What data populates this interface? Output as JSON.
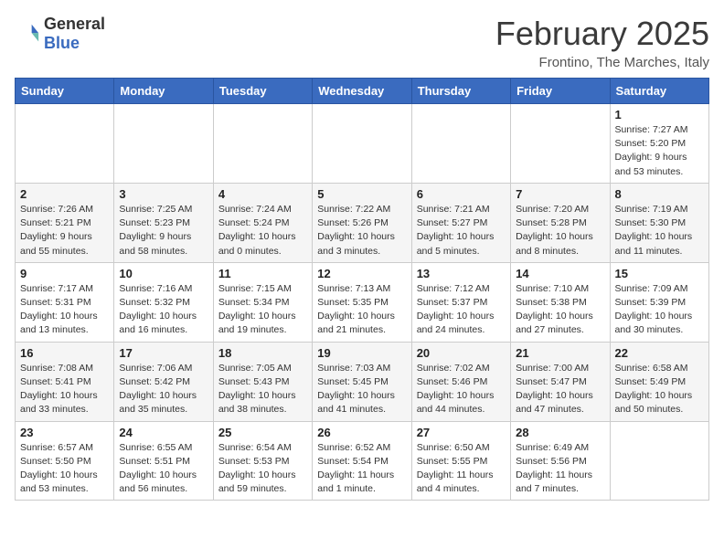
{
  "header": {
    "logo_general": "General",
    "logo_blue": "Blue",
    "month_title": "February 2025",
    "location": "Frontino, The Marches, Italy"
  },
  "days_of_week": [
    "Sunday",
    "Monday",
    "Tuesday",
    "Wednesday",
    "Thursday",
    "Friday",
    "Saturday"
  ],
  "weeks": [
    {
      "row_class": "row-white",
      "days": [
        {
          "num": "",
          "info": ""
        },
        {
          "num": "",
          "info": ""
        },
        {
          "num": "",
          "info": ""
        },
        {
          "num": "",
          "info": ""
        },
        {
          "num": "",
          "info": ""
        },
        {
          "num": "",
          "info": ""
        },
        {
          "num": "1",
          "info": "Sunrise: 7:27 AM\nSunset: 5:20 PM\nDaylight: 9 hours and 53 minutes."
        }
      ]
    },
    {
      "row_class": "row-alt",
      "days": [
        {
          "num": "2",
          "info": "Sunrise: 7:26 AM\nSunset: 5:21 PM\nDaylight: 9 hours and 55 minutes."
        },
        {
          "num": "3",
          "info": "Sunrise: 7:25 AM\nSunset: 5:23 PM\nDaylight: 9 hours and 58 minutes."
        },
        {
          "num": "4",
          "info": "Sunrise: 7:24 AM\nSunset: 5:24 PM\nDaylight: 10 hours and 0 minutes."
        },
        {
          "num": "5",
          "info": "Sunrise: 7:22 AM\nSunset: 5:26 PM\nDaylight: 10 hours and 3 minutes."
        },
        {
          "num": "6",
          "info": "Sunrise: 7:21 AM\nSunset: 5:27 PM\nDaylight: 10 hours and 5 minutes."
        },
        {
          "num": "7",
          "info": "Sunrise: 7:20 AM\nSunset: 5:28 PM\nDaylight: 10 hours and 8 minutes."
        },
        {
          "num": "8",
          "info": "Sunrise: 7:19 AM\nSunset: 5:30 PM\nDaylight: 10 hours and 11 minutes."
        }
      ]
    },
    {
      "row_class": "row-white",
      "days": [
        {
          "num": "9",
          "info": "Sunrise: 7:17 AM\nSunset: 5:31 PM\nDaylight: 10 hours and 13 minutes."
        },
        {
          "num": "10",
          "info": "Sunrise: 7:16 AM\nSunset: 5:32 PM\nDaylight: 10 hours and 16 minutes."
        },
        {
          "num": "11",
          "info": "Sunrise: 7:15 AM\nSunset: 5:34 PM\nDaylight: 10 hours and 19 minutes."
        },
        {
          "num": "12",
          "info": "Sunrise: 7:13 AM\nSunset: 5:35 PM\nDaylight: 10 hours and 21 minutes."
        },
        {
          "num": "13",
          "info": "Sunrise: 7:12 AM\nSunset: 5:37 PM\nDaylight: 10 hours and 24 minutes."
        },
        {
          "num": "14",
          "info": "Sunrise: 7:10 AM\nSunset: 5:38 PM\nDaylight: 10 hours and 27 minutes."
        },
        {
          "num": "15",
          "info": "Sunrise: 7:09 AM\nSunset: 5:39 PM\nDaylight: 10 hours and 30 minutes."
        }
      ]
    },
    {
      "row_class": "row-alt",
      "days": [
        {
          "num": "16",
          "info": "Sunrise: 7:08 AM\nSunset: 5:41 PM\nDaylight: 10 hours and 33 minutes."
        },
        {
          "num": "17",
          "info": "Sunrise: 7:06 AM\nSunset: 5:42 PM\nDaylight: 10 hours and 35 minutes."
        },
        {
          "num": "18",
          "info": "Sunrise: 7:05 AM\nSunset: 5:43 PM\nDaylight: 10 hours and 38 minutes."
        },
        {
          "num": "19",
          "info": "Sunrise: 7:03 AM\nSunset: 5:45 PM\nDaylight: 10 hours and 41 minutes."
        },
        {
          "num": "20",
          "info": "Sunrise: 7:02 AM\nSunset: 5:46 PM\nDaylight: 10 hours and 44 minutes."
        },
        {
          "num": "21",
          "info": "Sunrise: 7:00 AM\nSunset: 5:47 PM\nDaylight: 10 hours and 47 minutes."
        },
        {
          "num": "22",
          "info": "Sunrise: 6:58 AM\nSunset: 5:49 PM\nDaylight: 10 hours and 50 minutes."
        }
      ]
    },
    {
      "row_class": "row-white",
      "days": [
        {
          "num": "23",
          "info": "Sunrise: 6:57 AM\nSunset: 5:50 PM\nDaylight: 10 hours and 53 minutes."
        },
        {
          "num": "24",
          "info": "Sunrise: 6:55 AM\nSunset: 5:51 PM\nDaylight: 10 hours and 56 minutes."
        },
        {
          "num": "25",
          "info": "Sunrise: 6:54 AM\nSunset: 5:53 PM\nDaylight: 10 hours and 59 minutes."
        },
        {
          "num": "26",
          "info": "Sunrise: 6:52 AM\nSunset: 5:54 PM\nDaylight: 11 hours and 1 minute."
        },
        {
          "num": "27",
          "info": "Sunrise: 6:50 AM\nSunset: 5:55 PM\nDaylight: 11 hours and 4 minutes."
        },
        {
          "num": "28",
          "info": "Sunrise: 6:49 AM\nSunset: 5:56 PM\nDaylight: 11 hours and 7 minutes."
        },
        {
          "num": "",
          "info": ""
        }
      ]
    }
  ]
}
